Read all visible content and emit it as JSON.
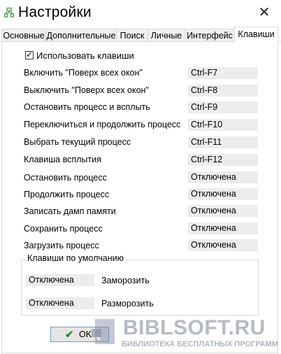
{
  "window": {
    "title": "Настройки",
    "close_glyph": "✕"
  },
  "tabs": [
    {
      "label": "Основные",
      "active": false
    },
    {
      "label": "Дополнительные",
      "active": false
    },
    {
      "label": "Поиск",
      "active": false
    },
    {
      "label": "Личные",
      "active": false
    },
    {
      "label": "Интерфейс",
      "active": false
    },
    {
      "label": "Клавиши",
      "active": true
    }
  ],
  "use_hotkeys": {
    "label": "Использовать клавиши",
    "checked": true
  },
  "hotkeys": [
    {
      "label": "Включить \"Поверх всех окон\"",
      "value": "Ctrl-F7"
    },
    {
      "label": "Выключить \"Поверх всех окон\"",
      "value": "Ctrl-F8"
    },
    {
      "label": "Остановить процесс и всплыть",
      "value": "Ctrl-F9"
    },
    {
      "label": "Переключиться и продолжить процесс",
      "value": "Ctrl-F10"
    },
    {
      "label": "Выбрать текущий процесс",
      "value": "Ctrl-F11"
    },
    {
      "label": "Клавиша всплытия",
      "value": "Ctrl-F12"
    },
    {
      "label": "Остановить процесс",
      "value": "Отключена"
    },
    {
      "label": "Продолжить процесс",
      "value": "Отключена"
    },
    {
      "label": "Записать дамп памяти",
      "value": "Отключена"
    },
    {
      "label": "Сохранить процесс",
      "value": "Отключена"
    },
    {
      "label": "Загрузить процесс",
      "value": "Отключена"
    }
  ],
  "defaults_group": {
    "title": "Клавиши по умолчанию",
    "rows": [
      {
        "value": "Отключена",
        "label": "Заморозить"
      },
      {
        "value": "Отключена",
        "label": "Разморозить"
      }
    ]
  },
  "buttons": {
    "ok_label": "OK"
  },
  "watermark": {
    "main": "BIBLSOFT.RU",
    "sub": "БИБЛИОТЕКА БЕСПЛАТНЫХ ПРОГРАММ"
  },
  "icons": {
    "app": "network-tree-icon",
    "close": "close-icon",
    "check": "checkmark-icon",
    "ok": "green-check-icon"
  },
  "colors": {
    "field_bg": "#ececec",
    "border": "#d9d9d9",
    "ok_border": "#6d9ad6",
    "ok_check": "#2f8f3a",
    "app_icon": "#3a8f3a"
  }
}
